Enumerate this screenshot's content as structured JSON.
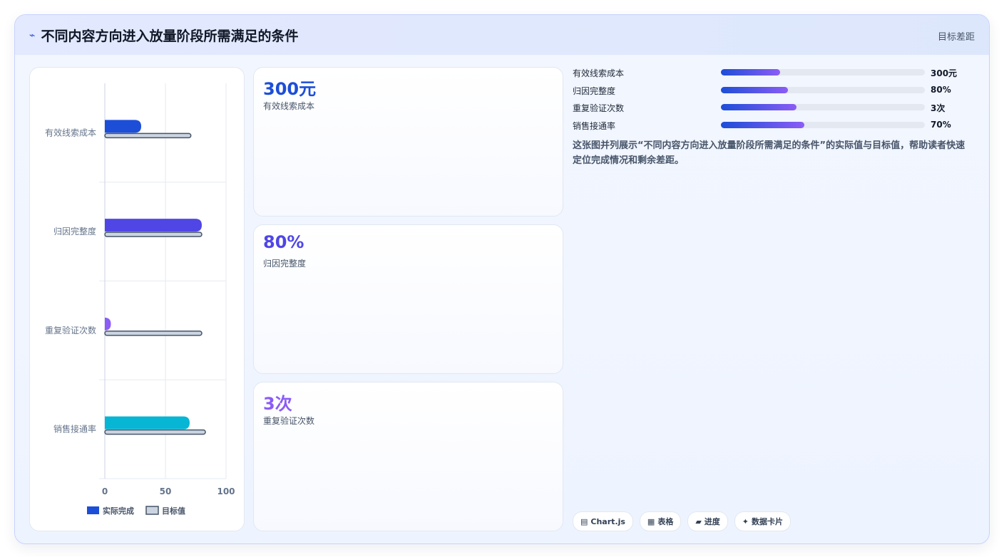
{
  "header": {
    "icon": "chart-line-icon",
    "title": "不同内容方向进入放量阶段所需满足的条件",
    "right_label": "目标差距"
  },
  "chart_data": {
    "type": "bar",
    "orientation": "horizontal",
    "categories": [
      "有效线索成本",
      "归因完整度",
      "重复验证次数",
      "销售接通率"
    ],
    "series": [
      {
        "name": "实际完成",
        "values": [
          30,
          80,
          5,
          70
        ],
        "colors": [
          "#1d4ed8",
          "#4f46e5",
          "#8b5cf6",
          "#06b6d4"
        ]
      },
      {
        "name": "目标值",
        "values": [
          71,
          80,
          80,
          83
        ],
        "color": "#cbd5e1",
        "stroke": "#475569"
      }
    ],
    "xlim": [
      0,
      100
    ],
    "xticks": [
      "0",
      "50",
      "100"
    ],
    "grid": true,
    "legend_position": "bottom"
  },
  "kpis": [
    {
      "value": "300元",
      "label": "有效线索成本",
      "color": "#1d4ed8"
    },
    {
      "value": "80%",
      "label": "归因完整度",
      "color": "#4f46e5"
    },
    {
      "value": "3次",
      "label": "重复验证次数",
      "color": "#8b5cf6"
    }
  ],
  "progress": [
    {
      "label": "有效线索成本",
      "value": "300元",
      "fraction": 0.29
    },
    {
      "label": "归因完整度",
      "value": "80%",
      "fraction": 0.33
    },
    {
      "label": "重复验证次数",
      "value": "3次",
      "fraction": 0.37
    },
    {
      "label": "销售接通率",
      "value": "70%",
      "fraction": 0.41
    }
  ],
  "description": "这张图并列展示“不同内容方向进入放量阶段所需满足的条件”的实际值与目标值，帮助读者快速定位完成情况和剩余差距。",
  "tags": [
    {
      "icon": "chart-icon",
      "glyph": "▤",
      "label": "Chart.js"
    },
    {
      "icon": "table-icon",
      "glyph": "▦",
      "label": "表格"
    },
    {
      "icon": "progress-icon",
      "glyph": "▰",
      "label": "进度"
    },
    {
      "icon": "sparkle-icon",
      "glyph": "✦",
      "label": "数据卡片"
    }
  ]
}
